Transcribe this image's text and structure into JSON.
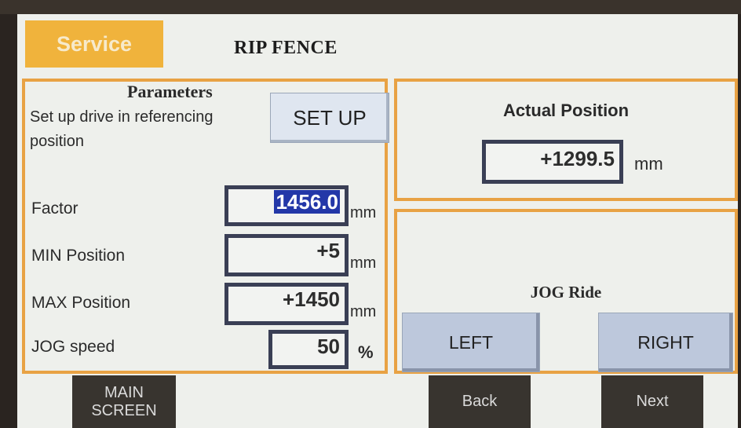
{
  "header": {
    "service_tab": "Service",
    "title": "RIP FENCE"
  },
  "parameters": {
    "title": "Parameters",
    "setup_text": "Set up drive in referencing position",
    "setup_button": "SET UP",
    "rows": [
      {
        "label": "Factor",
        "value": "1456.0",
        "unit": "mm"
      },
      {
        "label": "MIN Position",
        "value": "+5",
        "unit": "mm"
      },
      {
        "label": "MAX Position",
        "value": "+1450",
        "unit": "mm"
      },
      {
        "label": "JOG speed",
        "value": "50",
        "unit": "%"
      }
    ]
  },
  "actual": {
    "title": "Actual Position",
    "value": "+1299.5",
    "unit": "mm"
  },
  "jog": {
    "title": "JOG Ride",
    "left": "LEFT",
    "right": "RIGHT"
  },
  "nav": {
    "main_line1": "MAIN",
    "main_line2": "SCREEN",
    "back": "Back",
    "next": "Next"
  },
  "colors": {
    "accent": "#f0b33c",
    "border": "#e8a244",
    "selection": "#2337a8",
    "nav_bg": "#38342f"
  }
}
